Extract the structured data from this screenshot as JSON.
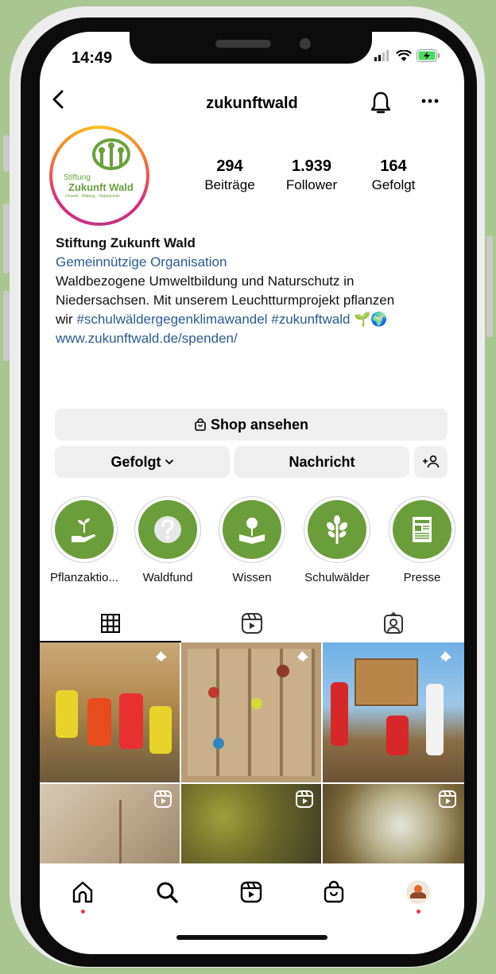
{
  "status_bar": {
    "time": "14:49"
  },
  "header": {
    "username": "zukunftwald"
  },
  "profile": {
    "logo": {
      "line1": "Stiftung",
      "line2": "Zukunft Wald",
      "line3": "Umwelt · Bildung · Naturschutz"
    },
    "stats": [
      {
        "value": "294",
        "label": "Beiträge"
      },
      {
        "value": "1.939",
        "label": "Follower"
      },
      {
        "value": "164",
        "label": "Gefolgt"
      }
    ],
    "name": "Stiftung Zukunft Wald",
    "category": "Gemeinnützige Organisation",
    "bio_line1": "Waldbezogene Umweltbildung und Naturschutz in",
    "bio_line2": "Niedersachsen. Mit unserem Leuchtturmprojekt pflanzen",
    "bio_line3_prefix": "wir ",
    "hashtag1": "#schulwäldergegenklimawandel",
    "hashtag2": "#zukunftwald",
    "bio_emoji": "🌱🌍",
    "website": "www.zukunftwald.de/spenden/"
  },
  "actions": {
    "shop": "Shop ansehen",
    "following": "Gefolgt",
    "message": "Nachricht"
  },
  "highlights": [
    {
      "label": "Pflanzaktio..."
    },
    {
      "label": "Waldfund"
    },
    {
      "label": "Wissen"
    },
    {
      "label": "Schulwälder"
    },
    {
      "label": "Presse"
    }
  ],
  "tabs": {
    "active": "grid-tab"
  },
  "grid": {
    "posts": [
      {
        "type": "pinned"
      },
      {
        "type": "pinned"
      },
      {
        "type": "pinned"
      },
      {
        "type": "reel"
      },
      {
        "type": "reel"
      },
      {
        "type": "reel"
      }
    ]
  },
  "bottom_nav": {
    "items": [
      "home-icon",
      "search-icon",
      "reels-icon",
      "shop-icon",
      "profile-avatar"
    ]
  },
  "colors": {
    "background": "#a9c690",
    "accent_green": "#6a9e3a",
    "link_blue": "#2b5a8f",
    "notification_dot": "#ff3040"
  }
}
